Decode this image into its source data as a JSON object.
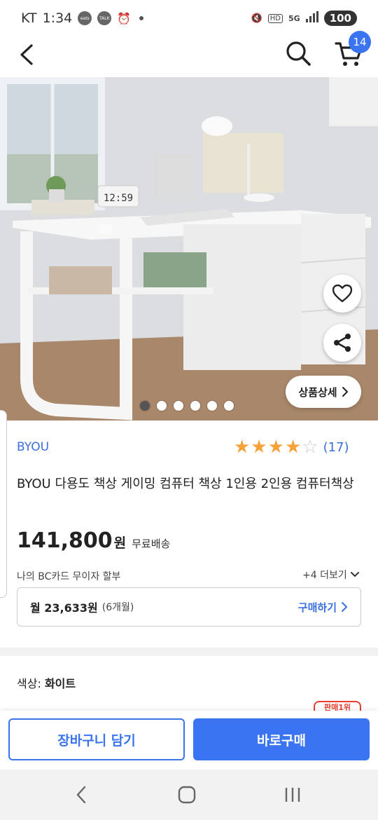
{
  "status_bar": {
    "carrier": "KT",
    "time": "1:34",
    "app_icons": [
      "coupang-eats-icon",
      "kakaotalk-icon",
      "alarm-icon"
    ],
    "network": "5G",
    "hd": "HD",
    "battery": "100"
  },
  "header": {
    "cart_count": "14"
  },
  "hero": {
    "image_description": "white office desk with drawers and shelf",
    "clock_text": "12:59",
    "detail_button_label": "상품상세",
    "image_count": 6,
    "active_index": 0
  },
  "product": {
    "brand": "BYOU",
    "rating": 4,
    "rating_max": 5,
    "review_count": "(17)",
    "title": "BYOU 다용도 책상 게이밍 컴퓨터 책상 1인용 2인용 컴퓨터책상",
    "price": "141,800",
    "price_unit": "원",
    "shipping": "무료배송",
    "card_label": "나의 BC카드 무이자 할부",
    "more_label": "+4 더보기",
    "installment_amount": "월 23,633원",
    "installment_months": "(6개월)",
    "installment_buy": "구매하기",
    "option_label": "색상:",
    "option_value": "화이트",
    "peek_badge": "판매1위"
  },
  "actions": {
    "add_to_cart": "장바구니 담기",
    "buy_now": "바로구매"
  },
  "colors": {
    "accent": "#3a74f0",
    "star": "#f5a23b"
  }
}
